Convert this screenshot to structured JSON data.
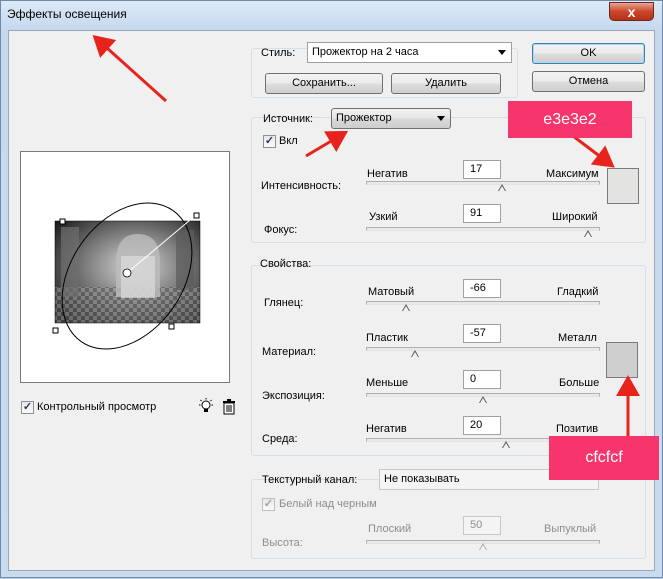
{
  "window": {
    "title": "Эффекты освещения",
    "close_glyph": "x"
  },
  "buttons": {
    "ok": "OK",
    "cancel": "Отмена",
    "save": "Сохранить...",
    "delete": "Удалить"
  },
  "style": {
    "label": "Стиль:",
    "value": "Прожектор на 2 часа"
  },
  "source": {
    "label": "Источник:",
    "value": "Прожектор",
    "on_label": "Вкл",
    "on_checked": true
  },
  "light": {
    "intensity": {
      "label": "Интенсивность:",
      "left": "Негатив",
      "right": "Максимум",
      "value": "17",
      "level": 0.58
    },
    "focus": {
      "label": "Фокус:",
      "left": "Узкий",
      "right": "Широкий",
      "value": "91",
      "level": 0.95
    },
    "color": "#e3e3e2"
  },
  "properties": {
    "title": "Свойства:",
    "gloss": {
      "label": "Глянец:",
      "left": "Матовый",
      "right": "Гладкий",
      "value": "-66",
      "level": 0.17
    },
    "material": {
      "label": "Материал:",
      "left": "Пластик",
      "right": "Металл",
      "value": "-57",
      "level": 0.21
    },
    "exposure": {
      "label": "Экспозиция:",
      "left": "Меньше",
      "right": "Больше",
      "value": "0",
      "level": 0.5
    },
    "ambience": {
      "label": "Среда:",
      "left": "Негатив",
      "right": "Позитив",
      "value": "20",
      "level": 0.6
    },
    "color": "#cfcfcf"
  },
  "texture": {
    "channel_label": "Текстурный канал:",
    "channel_value": "Не показывать",
    "white_high_label": "Белый над черным",
    "white_high_checked": true,
    "height_label": "Высота:",
    "left": "Плоский",
    "right": "Выпуклый",
    "value": "50",
    "level": 0.5
  },
  "preview": {
    "checkbox_label": "Контрольный просмотр",
    "checked": true,
    "light_icon": "light-bulb-icon",
    "trash_icon": "trash-icon"
  },
  "annotations": {
    "light_color_hex": "e3e3e2",
    "property_color_hex": "cfcfcf",
    "accent": "#f5356b",
    "arrow": "#e8231b"
  }
}
